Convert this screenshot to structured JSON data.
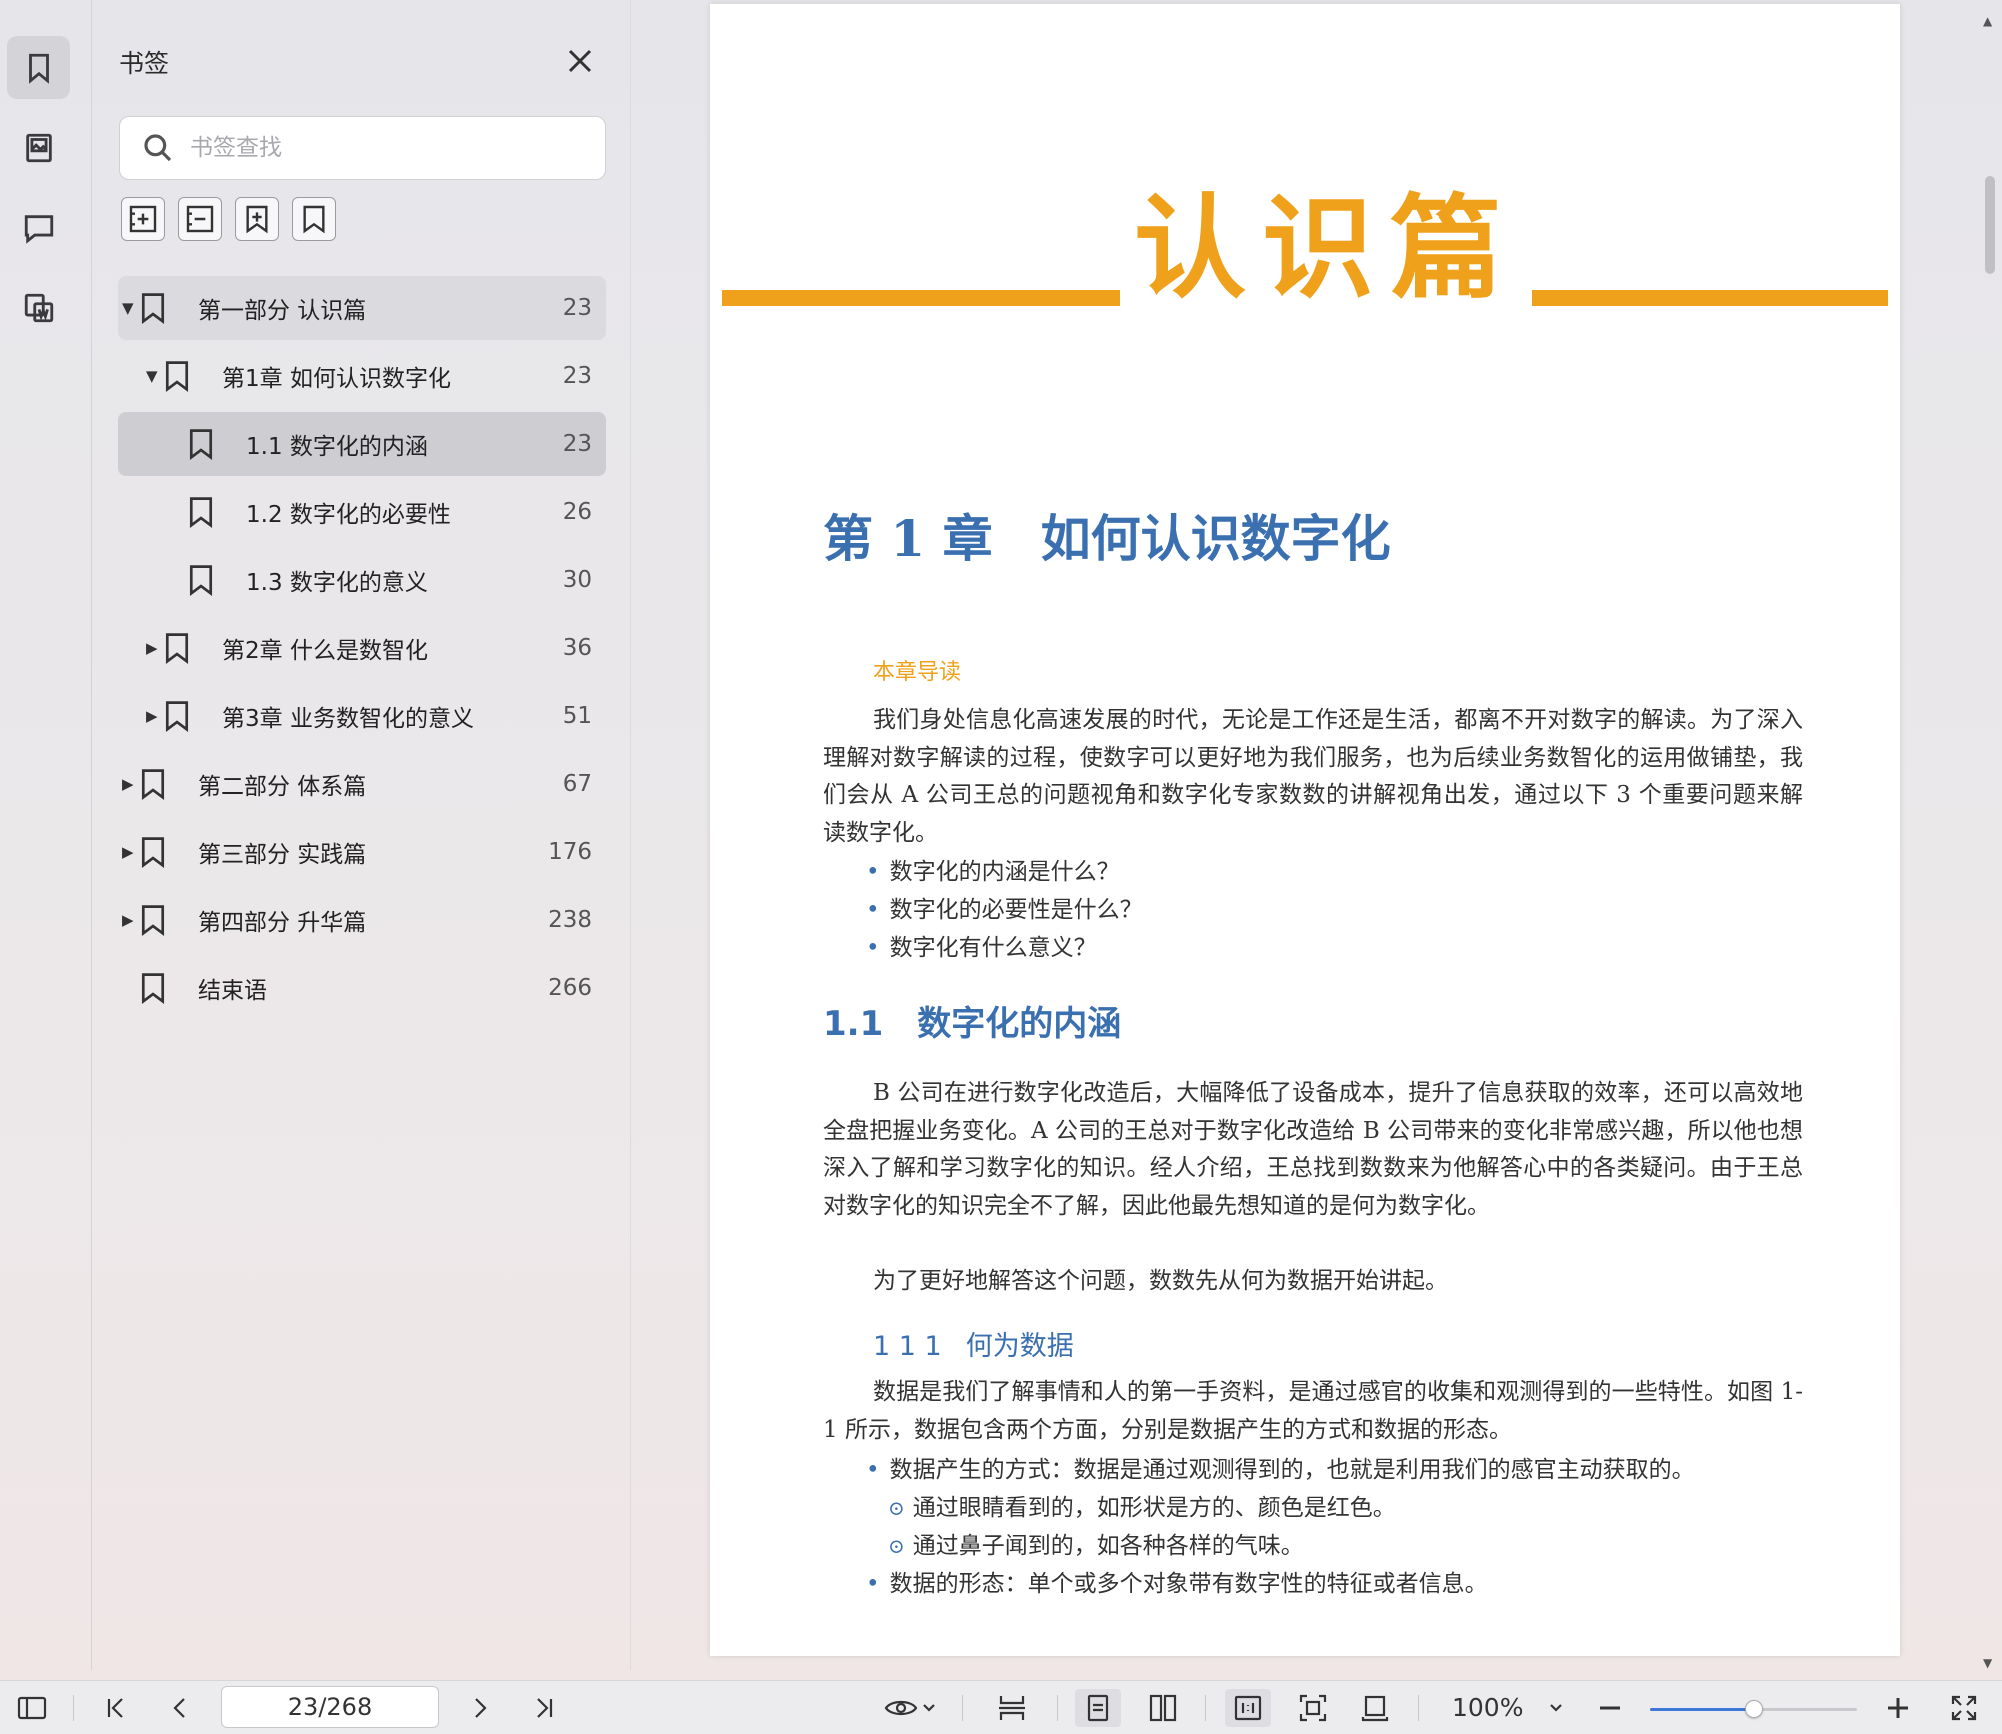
{
  "sidebar_panel": {
    "title": "书签",
    "search_placeholder": "书签查找",
    "tree": [
      {
        "label": "第一部分 认识篇",
        "page": "23",
        "level": 0,
        "arrow": "▼",
        "state": "parent-sel"
      },
      {
        "label": "第1章 如何认识数字化",
        "page": "23",
        "level": 1,
        "arrow": "▼",
        "state": ""
      },
      {
        "label": "1.1 数字化的内涵",
        "page": "23",
        "level": 2,
        "arrow": "",
        "state": "sel"
      },
      {
        "label": "1.2 数字化的必要性",
        "page": "26",
        "level": 2,
        "arrow": "",
        "state": ""
      },
      {
        "label": "1.3 数字化的意义",
        "page": "30",
        "level": 2,
        "arrow": "",
        "state": ""
      },
      {
        "label": "第2章 什么是数智化",
        "page": "36",
        "level": 1,
        "arrow": "▶",
        "state": ""
      },
      {
        "label": "第3章 业务数智化的意义",
        "page": "51",
        "level": 1,
        "arrow": "▶",
        "state": ""
      },
      {
        "label": "第二部分 体系篇",
        "page": "67",
        "level": 0,
        "arrow": "▶",
        "state": ""
      },
      {
        "label": "第三部分 实践篇",
        "page": "176",
        "level": 0,
        "arrow": "▶",
        "state": ""
      },
      {
        "label": "第四部分 升华篇",
        "page": "238",
        "level": 0,
        "arrow": "▶",
        "state": ""
      },
      {
        "label": "结束语",
        "page": "266",
        "level": 0,
        "arrow": "",
        "state": ""
      }
    ]
  },
  "document": {
    "banner": "认识篇",
    "chapter_num": "第 1 章",
    "chapter_name": "如何认识数字化",
    "lead_heading": "本章导读",
    "lead_para": "我们身处信息化高速发展的时代，无论是工作还是生活，都离不开对数字的解读。为了深入理解对数字解读的过程，使数字可以更好地为我们服务，也为后续业务数智化的运用做铺垫，我们会从 A 公司王总的问题视角和数字化专家数数的讲解视角出发，通过以下 3 个重要问题来解读数字化。",
    "lead_bullets": [
      "数字化的内涵是什么？",
      "数字化的必要性是什么？",
      "数字化有什么意义？"
    ],
    "section_num": "1.1",
    "section_name": "数字化的内涵",
    "section_para1": "B 公司在进行数字化改造后，大幅降低了设备成本，提升了信息获取的效率，还可以高效地全盘把握业务变化。A 公司的王总对于数字化改造给 B 公司带来的变化非常感兴趣，所以他也想深入了解和学习数字化的知识。经人介绍，王总找到数数来为他解答心中的各类疑问。由于王总对数字化的知识完全不了解，因此他最先想知道的是何为数字化。",
    "section_para2": "为了更好地解答这个问题，数数先从何为数据开始讲起。",
    "subsection_num": "1 1 1",
    "subsection_name": "何为数据",
    "sub_para": "数据是我们了解事情和人的第一手资料，是通过感官的收集和观测得到的一些特性。如图 1-1 所示，数据包含两个方面，分别是数据产生的方式和数据的形态。",
    "sub_b1": "数据产生的方式：数据是通过观测得到的，也就是利用我们的感官主动获取的。",
    "sub_b1_s1": "通过眼睛看到的，如形状是方的、颜色是红色。",
    "sub_b1_s2": "通过鼻子闻到的，如各种各样的气味。",
    "sub_b2": "数据的形态：单个或多个对象带有数字性的特征或者信息。"
  },
  "bottom_bar": {
    "page_indicator": "23/268",
    "zoom": "100%",
    "zoom_fraction": 0.5
  },
  "colors": {
    "accent_orange": "#f0a11c",
    "heading_blue": "#3a6fb0",
    "slider_blue": "#3d78d8"
  }
}
